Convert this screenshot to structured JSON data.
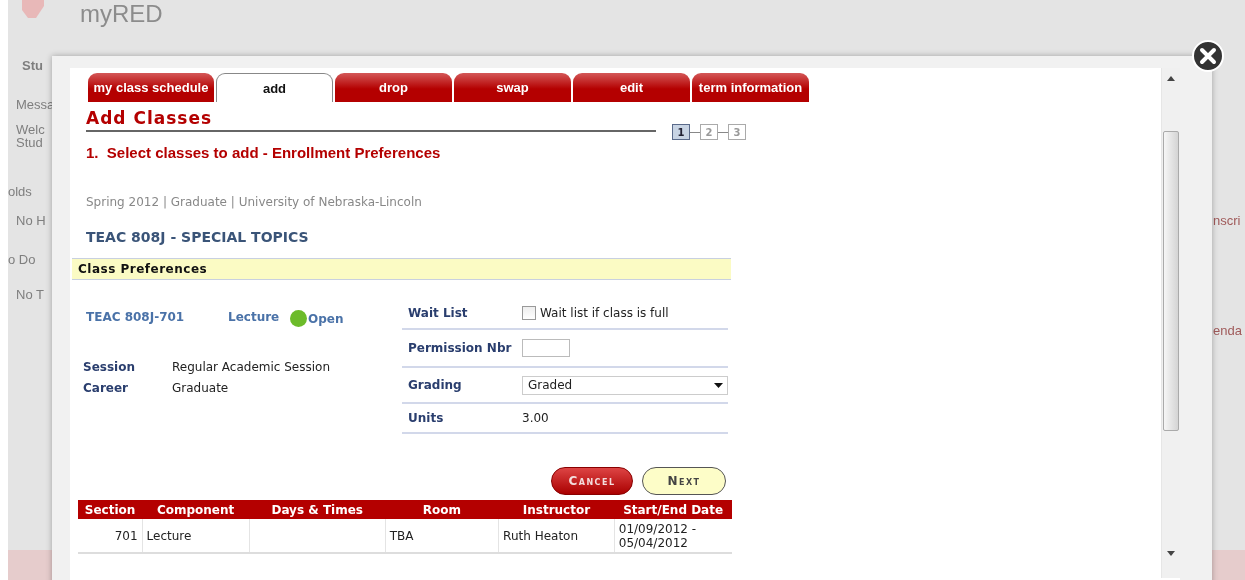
{
  "background_page": {
    "logo_text": "myRED",
    "left_fragments": [
      "Stu",
      "Messa",
      "Welc",
      "Stud",
      "olds",
      "No H",
      "o Do",
      "No T"
    ],
    "right_fragments": [
      "nscri",
      "enda"
    ]
  },
  "dialog": {
    "tabs": [
      {
        "label": "my class schedule",
        "selected": false
      },
      {
        "label": "add",
        "selected": true
      },
      {
        "label": "drop",
        "selected": false
      },
      {
        "label": "swap",
        "selected": false
      },
      {
        "label": "edit",
        "selected": false
      },
      {
        "label": "term information",
        "selected": false
      }
    ],
    "title": "Add Classes",
    "steps": [
      {
        "label": "1",
        "selected": true
      },
      {
        "label": "2",
        "selected": false
      },
      {
        "label": "3",
        "selected": false
      }
    ],
    "step_heading": "1.  Select classes to add - Enrollment Preferences",
    "term_info": "Spring 2012 | Graduate | University of Nebraska-Lincoln",
    "course_title": "TEAC  808J - SPECIAL TOPICS",
    "section_header": "Class Preferences",
    "class_section": {
      "section": "TEAC  808J-701",
      "component": "Lecture",
      "status": {
        "label": "Open",
        "kind": "open"
      }
    },
    "details": [
      {
        "label": "Session",
        "value": "Regular Academic Session"
      },
      {
        "label": "Career",
        "value": "Graduate"
      }
    ],
    "preferences": [
      {
        "kind": "checkbox",
        "label": "Wait List",
        "text": "Wait list if class is full",
        "checked": false
      },
      {
        "kind": "input",
        "label": "Permission Nbr"
      },
      {
        "kind": "select",
        "label": "Grading",
        "value": "Graded"
      },
      {
        "kind": "text",
        "label": "Units",
        "value": "3.00"
      }
    ],
    "buttons": [
      {
        "kind": "cancel",
        "label": "Cancel"
      },
      {
        "kind": "next",
        "label": "Next"
      }
    ],
    "table": {
      "columns": [
        "Section",
        "Component",
        "Days & Times",
        "Room",
        "Instructor",
        "Start/End Date"
      ],
      "rows": [
        [
          "701",
          "Lecture",
          "",
          "TBA",
          "Ruth Heaton",
          "01/09/2012 - 05/04/2012"
        ]
      ]
    }
  }
}
